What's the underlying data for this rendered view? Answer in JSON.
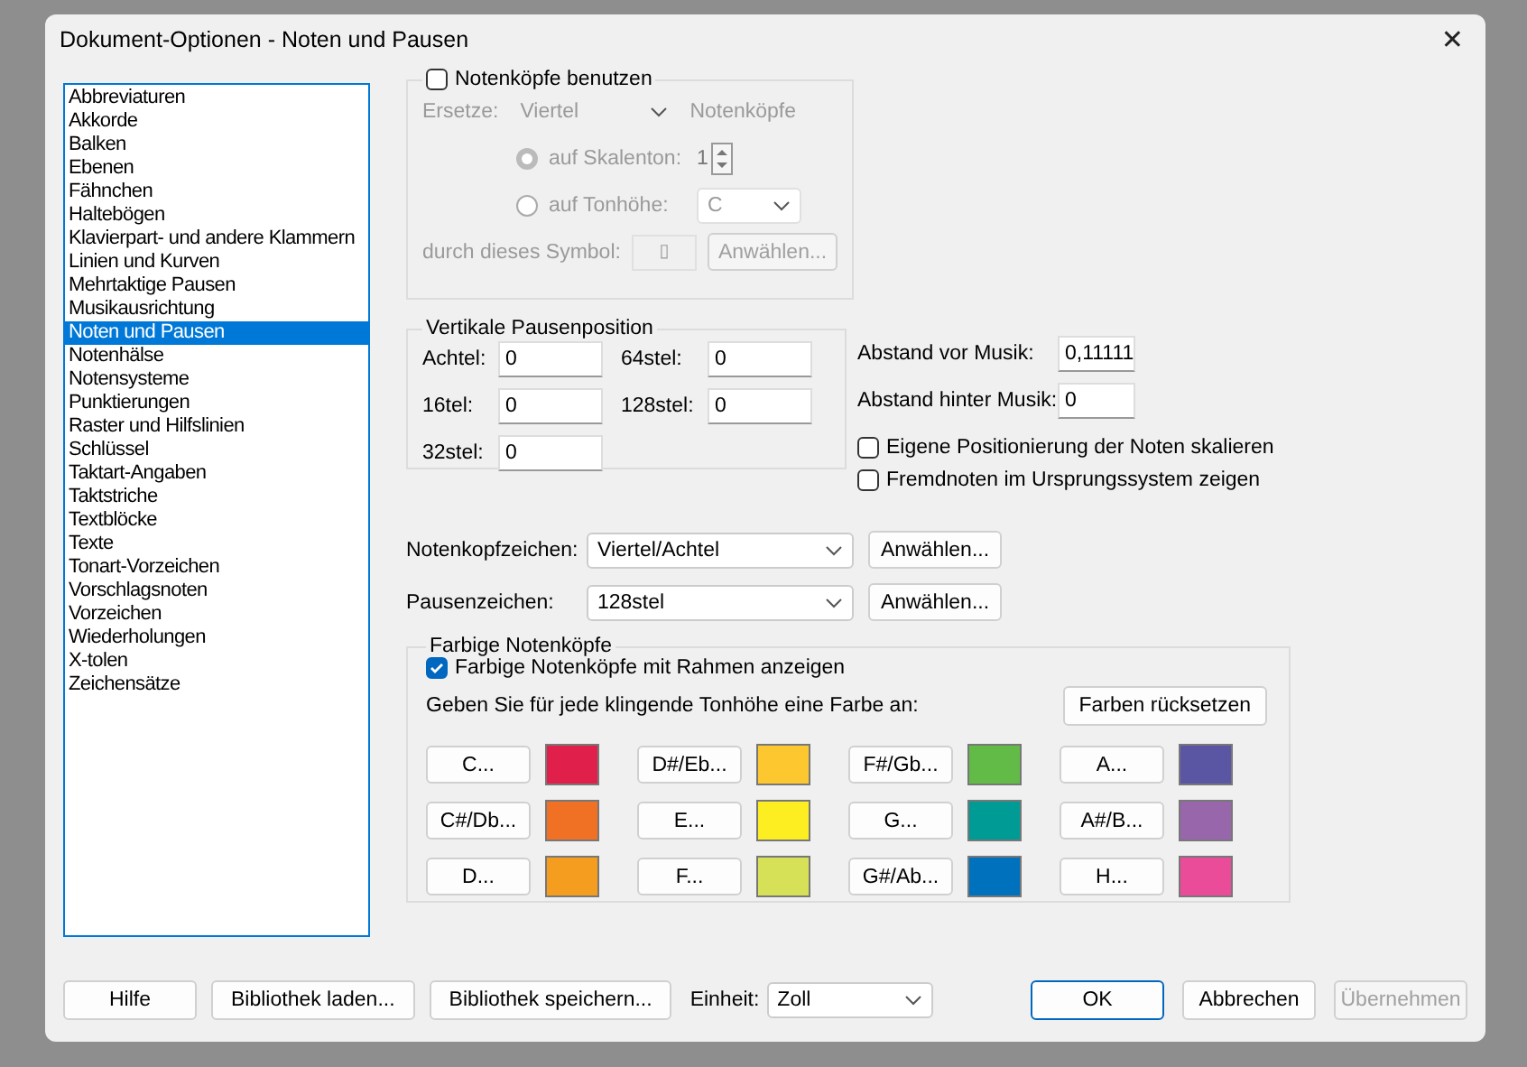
{
  "window": {
    "title": "Dokument-Optionen - Noten und Pausen",
    "close": "✕"
  },
  "categories": [
    {
      "label": "Abbreviaturen",
      "selected": false
    },
    {
      "label": "Akkorde",
      "selected": false
    },
    {
      "label": "Balken",
      "selected": false
    },
    {
      "label": "Ebenen",
      "selected": false
    },
    {
      "label": "Fähnchen",
      "selected": false
    },
    {
      "label": "Haltebögen",
      "selected": false
    },
    {
      "label": "Klavierpart- und andere Klammern",
      "selected": false
    },
    {
      "label": "Linien und Kurven",
      "selected": false
    },
    {
      "label": "Mehrtaktige Pausen",
      "selected": false
    },
    {
      "label": "Musikausrichtung",
      "selected": false
    },
    {
      "label": "Noten und Pausen",
      "selected": true
    },
    {
      "label": "Notenhälse",
      "selected": false
    },
    {
      "label": "Notensysteme",
      "selected": false
    },
    {
      "label": "Punktierungen",
      "selected": false
    },
    {
      "label": "Raster und Hilfslinien",
      "selected": false
    },
    {
      "label": "Schlüssel",
      "selected": false
    },
    {
      "label": "Taktart-Angaben",
      "selected": false
    },
    {
      "label": "Taktstriche",
      "selected": false
    },
    {
      "label": "Textblöcke",
      "selected": false
    },
    {
      "label": "Texte",
      "selected": false
    },
    {
      "label": "Tonart-Vorzeichen",
      "selected": false
    },
    {
      "label": "Vorschlagsnoten",
      "selected": false
    },
    {
      "label": "Vorzeichen",
      "selected": false
    },
    {
      "label": "Wiederholungen",
      "selected": false
    },
    {
      "label": "X-tolen",
      "selected": false
    },
    {
      "label": "Zeichensätze",
      "selected": false
    }
  ],
  "noteheads": {
    "label": "Notenköpfe benutzen",
    "checked": false,
    "replace_label": "Ersetze:",
    "replace_value": "Viertel",
    "replace_suffix": "Notenköpfe",
    "radios": [
      {
        "label": "auf Skalenton:",
        "selected": true,
        "kind": "spin",
        "value": "1"
      },
      {
        "label": "auf Tonhöhe:",
        "selected": false,
        "kind": "combo",
        "value": "C"
      }
    ],
    "symbol_label": "durch dieses Symbol:",
    "symbol_value": "▯",
    "choose_button": "Anwählen..."
  },
  "rest_position": {
    "title": "Vertikale Pausenposition",
    "fields": [
      {
        "label": "Achtel:",
        "value": "0"
      },
      {
        "label": "64stel:",
        "value": "0"
      },
      {
        "label": "16tel:",
        "value": "0"
      },
      {
        "label": "128stel:",
        "value": "0"
      },
      {
        "label": "32stel:",
        "value": "0"
      }
    ]
  },
  "spacing": [
    {
      "label": "Abstand vor Musik:",
      "value": "0,11111"
    },
    {
      "label": "Abstand hinter Musik:",
      "value": "0"
    }
  ],
  "options": [
    {
      "label": "Eigene Positionierung der Noten skalieren",
      "checked": false
    },
    {
      "label": "Fremdnoten im Ursprungssystem zeigen",
      "checked": false
    }
  ],
  "symbols": [
    {
      "label": "Notenkopfzeichen:",
      "value": "Viertel/Achtel",
      "button": "Anwählen..."
    },
    {
      "label": "Pausenzeichen:",
      "value": "128stel",
      "button": "Anwählen..."
    }
  ],
  "colored": {
    "title": "Farbige Notenköpfe",
    "checkbox": {
      "label": "Farbige Notenköpfe mit Rahmen anzeigen",
      "checked": true
    },
    "hint": "Geben Sie für jede klingende Tonhöhe eine Farbe an:",
    "reset_button": "Farben rücksetzen",
    "pitches": [
      {
        "label": "C...",
        "color": "#e01f4a"
      },
      {
        "label": "C#/Db...",
        "color": "#f07124"
      },
      {
        "label": "D...",
        "color": "#f59d1e"
      },
      {
        "label": "D#/Eb...",
        "color": "#fdc82f"
      },
      {
        "label": "E...",
        "color": "#fcee21"
      },
      {
        "label": "F...",
        "color": "#d6e157"
      },
      {
        "label": "F#/Gb...",
        "color": "#62bb47"
      },
      {
        "label": "G...",
        "color": "#009b95"
      },
      {
        "label": "G#/Ab...",
        "color": "#0071bd"
      },
      {
        "label": "A...",
        "color": "#5a56a4"
      },
      {
        "label": "A#/B...",
        "color": "#9766ab"
      },
      {
        "label": "H...",
        "color": "#ea4c99"
      }
    ]
  },
  "footer": {
    "left_buttons": [
      "Hilfe",
      "Bibliothek laden...",
      "Bibliothek speichern..."
    ],
    "unit_label": "Einheit:",
    "unit_value": "Zoll",
    "right_buttons": [
      {
        "label": "OK",
        "disabled": false,
        "default": true
      },
      {
        "label": "Abbrechen",
        "disabled": false,
        "default": false
      },
      {
        "label": "Übernehmen",
        "disabled": true,
        "default": false
      }
    ]
  }
}
